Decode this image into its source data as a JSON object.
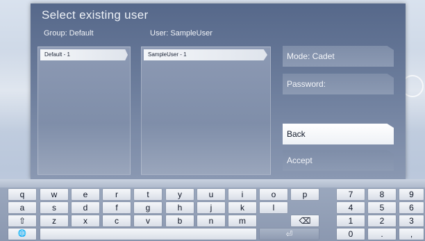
{
  "dialog": {
    "title": "Select existing user",
    "group_header": "Group: Default",
    "user_header": "User: SampleUser",
    "groups": [
      "Default - 1"
    ],
    "users": [
      "SampleUser - 1"
    ]
  },
  "side_buttons": {
    "mode": "Mode: Cadet",
    "password": "Password:",
    "back": "Back",
    "accept": "Accept"
  },
  "keyboard": {
    "row1": [
      "q",
      "w",
      "e",
      "r",
      "t",
      "y",
      "u",
      "i",
      "o",
      "p"
    ],
    "row2": [
      "a",
      "s",
      "d",
      "f",
      "g",
      "h",
      "j",
      "k",
      "l"
    ],
    "row3": [
      "⇧",
      "z",
      "x",
      "c",
      "v",
      "b",
      "n",
      "m"
    ],
    "backspace": "⌫",
    "globe": "🌐",
    "enter": "⏎",
    "numpad": [
      "7",
      "8",
      "9",
      "4",
      "5",
      "6",
      "1",
      "2",
      "3",
      "0",
      ".",
      ","
    ]
  }
}
